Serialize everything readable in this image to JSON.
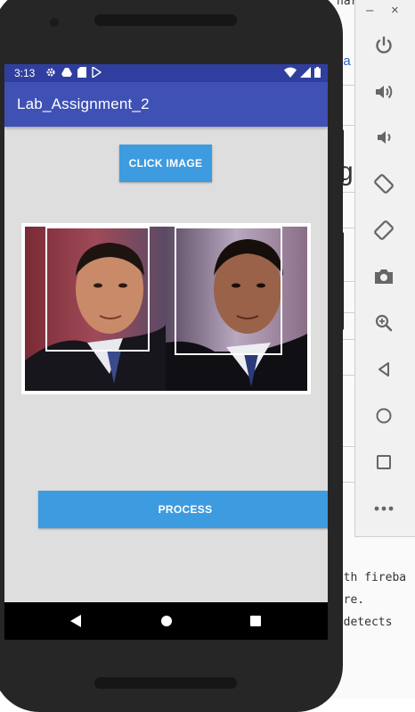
{
  "background_ide": {
    "fragments": [
      {
        "text": "narket"
      },
      {
        "text": "la"
      },
      {
        "text": "g"
      },
      {
        "text": "t"
      },
      {
        "text": "vith fireba"
      },
      {
        "text": "ture."
      },
      {
        "text": "t detects"
      }
    ]
  },
  "emulator": {
    "minimize_label": "–",
    "close_label": "×",
    "controls": [
      {
        "name": "power-icon"
      },
      {
        "name": "volume-up-icon"
      },
      {
        "name": "volume-down-icon"
      },
      {
        "name": "rotate-left-icon"
      },
      {
        "name": "rotate-right-icon"
      },
      {
        "name": "camera-icon"
      },
      {
        "name": "zoom-icon"
      },
      {
        "name": "back-icon"
      },
      {
        "name": "home-icon"
      },
      {
        "name": "overview-icon"
      },
      {
        "name": "more-icon"
      }
    ]
  },
  "status_bar": {
    "time": "3:13"
  },
  "app": {
    "title": "Lab_Assignment_2",
    "click_image_label": "CLICK IMAGE",
    "process_label": "PROCESS"
  },
  "colors": {
    "status_bar": "#303f9f",
    "app_bar": "#3f51b5",
    "button": "#3d9be0",
    "screen_bg": "#dedede"
  }
}
